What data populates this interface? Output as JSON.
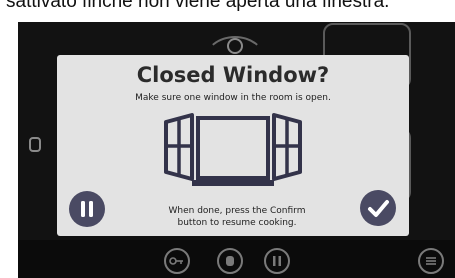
{
  "caption": {
    "text": "sattivato finché non viene aperta una finestra."
  },
  "dialog": {
    "title": "Closed Window?",
    "subtitle": "Make sure one window in the room is open.",
    "instruction_line1": "When done, press the Confirm",
    "instruction_line2": "button to resume cooking.",
    "pause_icon": "pause-icon",
    "confirm_icon": "checkmark-icon",
    "illustration_icon": "open-window-icon"
  },
  "bottom_bar": {
    "icons": [
      "key-icon",
      "hand-icon",
      "pause-icon",
      "menu-icon"
    ]
  },
  "colors": {
    "dialog_bg": "#e3e3e3",
    "button_bg": "#4a4a63",
    "screen_bg": "#121212",
    "illustration": "#33334a"
  }
}
